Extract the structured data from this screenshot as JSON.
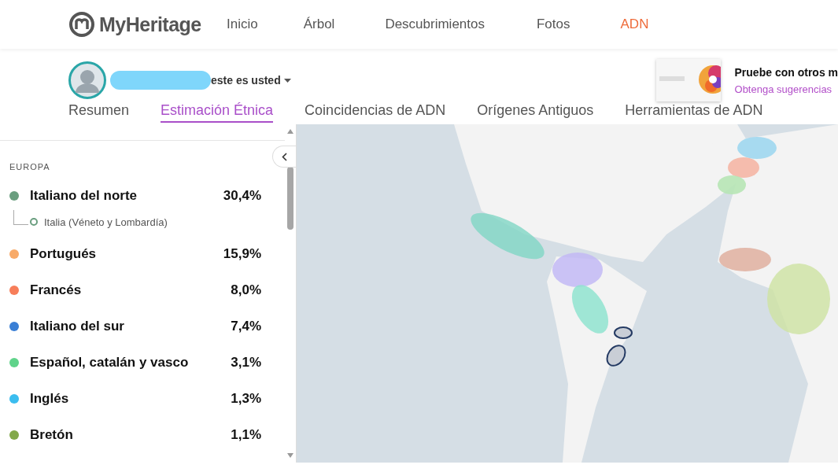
{
  "header": {
    "logo": "MyHeritage",
    "nav": [
      {
        "label": "Inicio",
        "selected": false
      },
      {
        "label": "Árbol",
        "selected": false
      },
      {
        "label": "Descubrimientos",
        "selected": false
      },
      {
        "label": "Fotos",
        "selected": false
      },
      {
        "label": "ADN",
        "selected": true
      }
    ]
  },
  "profile": {
    "label": "este es usted"
  },
  "promo": {
    "title": "Pruebe con otros m",
    "link": "Obtenga sugerencias"
  },
  "tabs": [
    {
      "label": "Resumen",
      "selected": false
    },
    {
      "label": "Estimación Étnica",
      "selected": true
    },
    {
      "label": "Coincidencias de ADN",
      "selected": false
    },
    {
      "label": "Orígenes Antiguos",
      "selected": false
    },
    {
      "label": "Herramientas de ADN",
      "selected": false
    }
  ],
  "ethnicity": {
    "region": "EUROPA",
    "items": [
      {
        "name": "Italiano del norte",
        "percent": "30,4%",
        "color": "#6a9e7f",
        "children": [
          {
            "name": "Italia (Véneto y Lombardía)",
            "color": "#6a9e7f"
          }
        ]
      },
      {
        "name": "Portugués",
        "percent": "15,9%",
        "color": "#f8aa68"
      },
      {
        "name": "Francés",
        "percent": "8,0%",
        "color": "#f77e5a"
      },
      {
        "name": "Italiano del sur",
        "percent": "7,4%",
        "color": "#3a7fd5"
      },
      {
        "name": "Español, catalán y vasco",
        "percent": "3,1%",
        "color": "#5fd38a"
      },
      {
        "name": "Inglés",
        "percent": "1,3%",
        "color": "#3bbdef"
      },
      {
        "name": "Bretón",
        "percent": "1,1%",
        "color": "#82a84a"
      }
    ]
  }
}
